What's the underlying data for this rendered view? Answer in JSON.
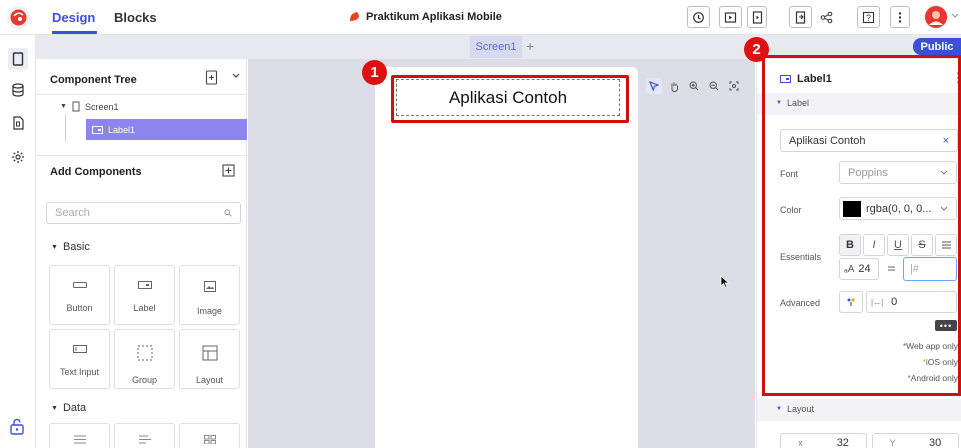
{
  "header": {
    "tabs": [
      {
        "label": "Design"
      },
      {
        "label": "Blocks"
      }
    ],
    "project_title": "Praktikum Aplikasi Mobile"
  },
  "screen_bar": {
    "screen_tab": "Screen1",
    "add_symbol": "+",
    "public_badge": "Public"
  },
  "component_tree": {
    "title": "Component Tree",
    "screen_item": "Screen1",
    "label_item": "Label1"
  },
  "add_components": {
    "title": "Add Components",
    "search_placeholder": "Search",
    "basic_section": "Basic",
    "basic_items": [
      {
        "label": "Button",
        "icon": "button-icon"
      },
      {
        "label": "Label",
        "icon": "label-icon"
      },
      {
        "label": "Image",
        "icon": "image-icon"
      },
      {
        "label": "Text Input",
        "icon": "text-input-icon"
      },
      {
        "label": "Group",
        "icon": "group-icon"
      },
      {
        "label": "Layout",
        "icon": "layout-icon"
      }
    ],
    "data_section": "Data"
  },
  "canvas": {
    "label_text": "Aplikasi Contoh",
    "badge_1": "1",
    "badge_2": "2"
  },
  "properties": {
    "title": "Label1",
    "menu": "⋮",
    "section_label": "Label",
    "text_value": "Aplikasi Contoh",
    "clear": "×",
    "font_label": "Font",
    "font_value": "Poppins",
    "color_label": "Color",
    "color_value": "rgba(0, 0, 0...",
    "essentials_label": "Essentials",
    "font_size": "24",
    "letter_spacing_placeholder": "|#",
    "advanced_label": "Advanced",
    "advanced_value": "0",
    "more": "•••",
    "notes": [
      {
        "text": "Web app only",
        "color": "#3d4fd7"
      },
      {
        "text": "iOS only",
        "color": "#e5a100"
      },
      {
        "text": "Android only",
        "color": "#1aa34a"
      }
    ],
    "section_layout": "Layout",
    "x_label": "x",
    "x_value": "32",
    "y_label": "Y",
    "y_value": "30"
  },
  "colors": {
    "accent": "#3d4fd7",
    "highlight_red": "#d10f0f",
    "tree_selected": "#8b86ee"
  }
}
